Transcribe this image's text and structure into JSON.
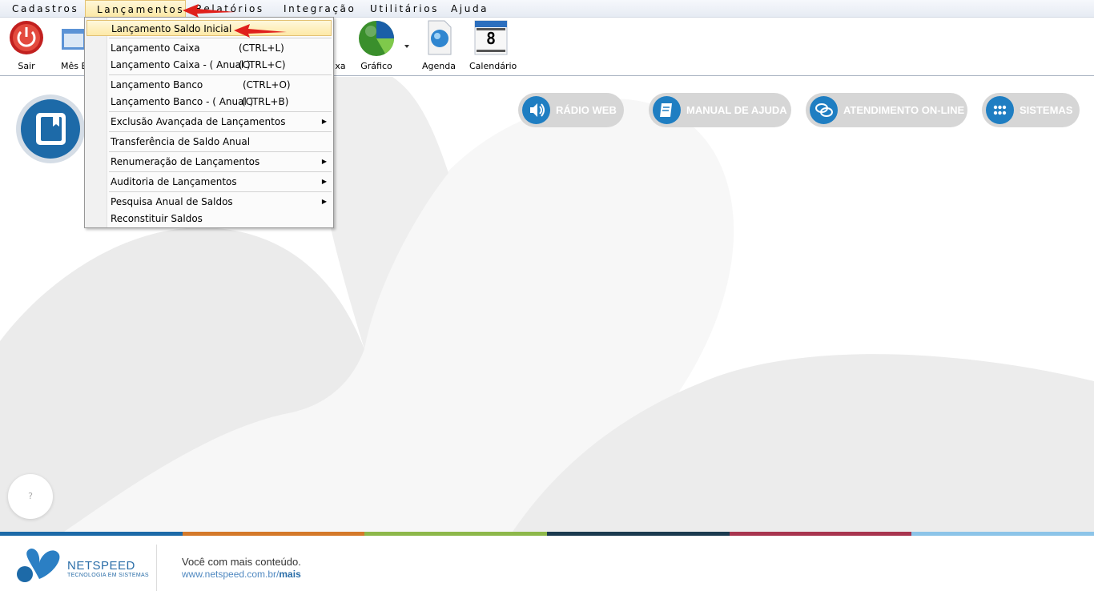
{
  "menubar": {
    "items": [
      {
        "label": "Cadastros"
      },
      {
        "label": "Lançamentos"
      },
      {
        "label": "Relatórios"
      },
      {
        "label": "Integração"
      },
      {
        "label": "Utilitários"
      },
      {
        "label": "Ajuda"
      }
    ]
  },
  "toolbar": {
    "sair": "Sair",
    "mes": "Mês B",
    "caixa": "xa",
    "grafico": "Gráfico",
    "agenda": "Agenda",
    "calendario": "Calendário",
    "calendar_day": "8"
  },
  "dropdown": {
    "items": [
      {
        "label": "Lançamento Saldo Inicial",
        "shortcut": ""
      },
      {
        "label": "Lançamento Caixa",
        "shortcut": "(CTRL+L)"
      },
      {
        "label": "Lançamento Caixa - ( Anual )",
        "shortcut": "(CTRL+C)"
      },
      {
        "label": "Lançamento Banco",
        "shortcut": "(CTRL+O)"
      },
      {
        "label": "Lançamento Banco - ( Anual )",
        "shortcut": "(CTRL+B)"
      },
      {
        "label": "Exclusão Avançada de Lançamentos",
        "shortcut": ""
      },
      {
        "label": "Transferência de Saldo Anual",
        "shortcut": ""
      },
      {
        "label": "Renumeração de Lançamentos",
        "shortcut": ""
      },
      {
        "label": "Auditoria de Lançamentos",
        "shortcut": ""
      },
      {
        "label": "Pesquisa Anual de Saldos",
        "shortcut": ""
      },
      {
        "label": "Reconstituir Saldos",
        "shortcut": ""
      }
    ]
  },
  "pills": {
    "radio": "RÁDIO WEB",
    "manual": "MANUAL DE AJUDA",
    "atendimento": "ATENDIMENTO ON-LINE",
    "sistemas": "SISTEMAS"
  },
  "help": "?",
  "footer": {
    "brand": "NETSPEED",
    "brand_sub": "TECNOLOGIA EM SISTEMAS",
    "tagline": "Você com mais conteúdo.",
    "link_prefix": "www.netspeed.com.br/",
    "link_suffix": "mais"
  },
  "colors": {
    "accent_blue": "#1f7ec2",
    "stripe": [
      "#1d6aa8",
      "#d4792a",
      "#8db84a",
      "#1b3a4f",
      "#a8344e",
      "#8cc4e8"
    ]
  }
}
